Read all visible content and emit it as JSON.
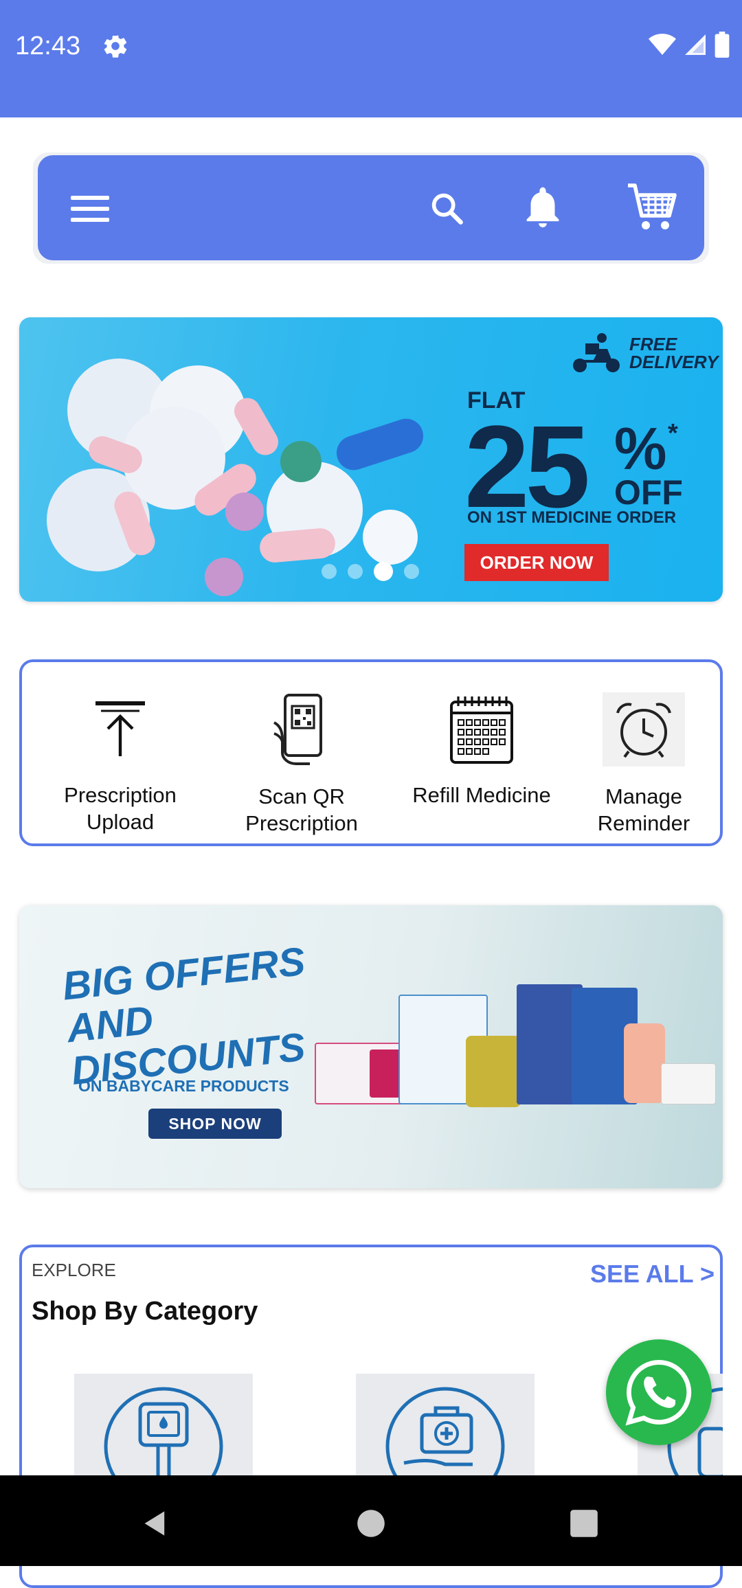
{
  "status_bar": {
    "time": "12:43",
    "icons": [
      "settings-icon",
      "wifi-icon",
      "signal-icon",
      "battery-icon"
    ]
  },
  "app_bar": {
    "icons": [
      "menu-icon",
      "search-icon",
      "bell-icon",
      "cart-icon"
    ]
  },
  "promo_banner": {
    "delivery": "FREE\nDELIVERY",
    "flat": "FLAT",
    "amount": "25",
    "percent": "%",
    "asterisk": "*",
    "off": "OFF",
    "subtitle": "ON 1ST MEDICINE ORDER",
    "cta": "ORDER NOW",
    "carousel": {
      "count": 4,
      "active_index": 2
    }
  },
  "quick_actions": [
    {
      "label": "Prescription Upload",
      "icon": "upload-icon"
    },
    {
      "label": "Scan QR Prescription",
      "icon": "qr-scan-icon"
    },
    {
      "label": "Refill Medicine",
      "icon": "calendar-icon"
    },
    {
      "label": "Manage Reminder",
      "icon": "alarm-clock-icon"
    }
  ],
  "babycare_banner": {
    "headline": "BIG OFFERS AND DISCOUNTS",
    "subtitle": "ON BABYCARE PRODUCTS",
    "cta": "SHOP NOW"
  },
  "category_section": {
    "eyebrow": "EXPLORE",
    "title": "Shop By Category",
    "see_all": "SEE ALL >"
  },
  "colors": {
    "primary": "#5b7bea",
    "whatsapp": "#29b84e",
    "promo_red": "#e12a2a"
  }
}
